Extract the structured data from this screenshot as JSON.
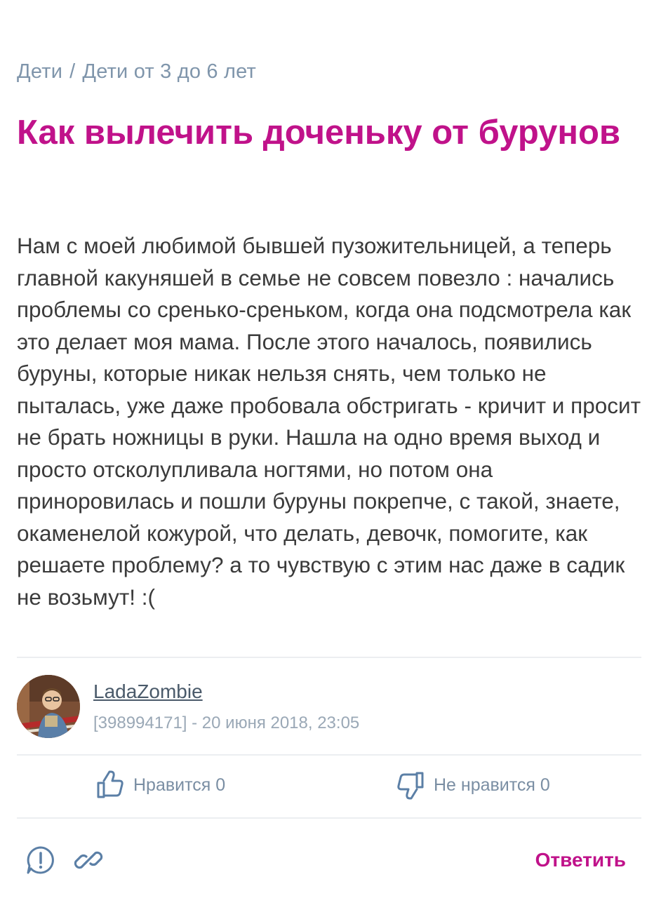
{
  "breadcrumb": {
    "items": [
      "Дети",
      "Дети от 3 до 6 лет"
    ],
    "separator": "/"
  },
  "post": {
    "title": "Как вылечить доченьку от бурунов",
    "body": "Нам с моей любимой бывшей пузожительницей, а теперь главной какуняшей в семье не совсем повезло : начались проблемы со сренько-среньком, когда она подсмотрела как это делает моя мама. После этого началось, появились буруны, которые никак нельзя снять, чем только не пыталась, уже даже пробовала обстригать - кричит и просит не брать ножницы в руки. Нашла на одно время выход и просто отсколупливала ногтями, но потом она приноровилась и пошли буруны покрепче, с такой, знаете, окаменелой кожурой, что делать, девочк, помогите, как решаете проблему? а то чувствую с этим нас даже в садик не возьмут! :("
  },
  "author": {
    "name": "LadaZombie",
    "meta": "[398994171] - 20 июня 2018, 23:05",
    "avatar_icon": "user-avatar-photo"
  },
  "votes": {
    "like_label": "Нравится 0",
    "dislike_label": "Не нравится 0",
    "like_icon": "thumbs-up-icon",
    "dislike_icon": "thumbs-down-icon"
  },
  "footer": {
    "report_icon": "report-icon",
    "link_icon": "link-icon",
    "reply_label": "Ответить"
  },
  "colors": {
    "accent": "#c0128a",
    "muted": "#7f95ab",
    "text": "#3b3b3b",
    "divider": "#eceef1"
  }
}
